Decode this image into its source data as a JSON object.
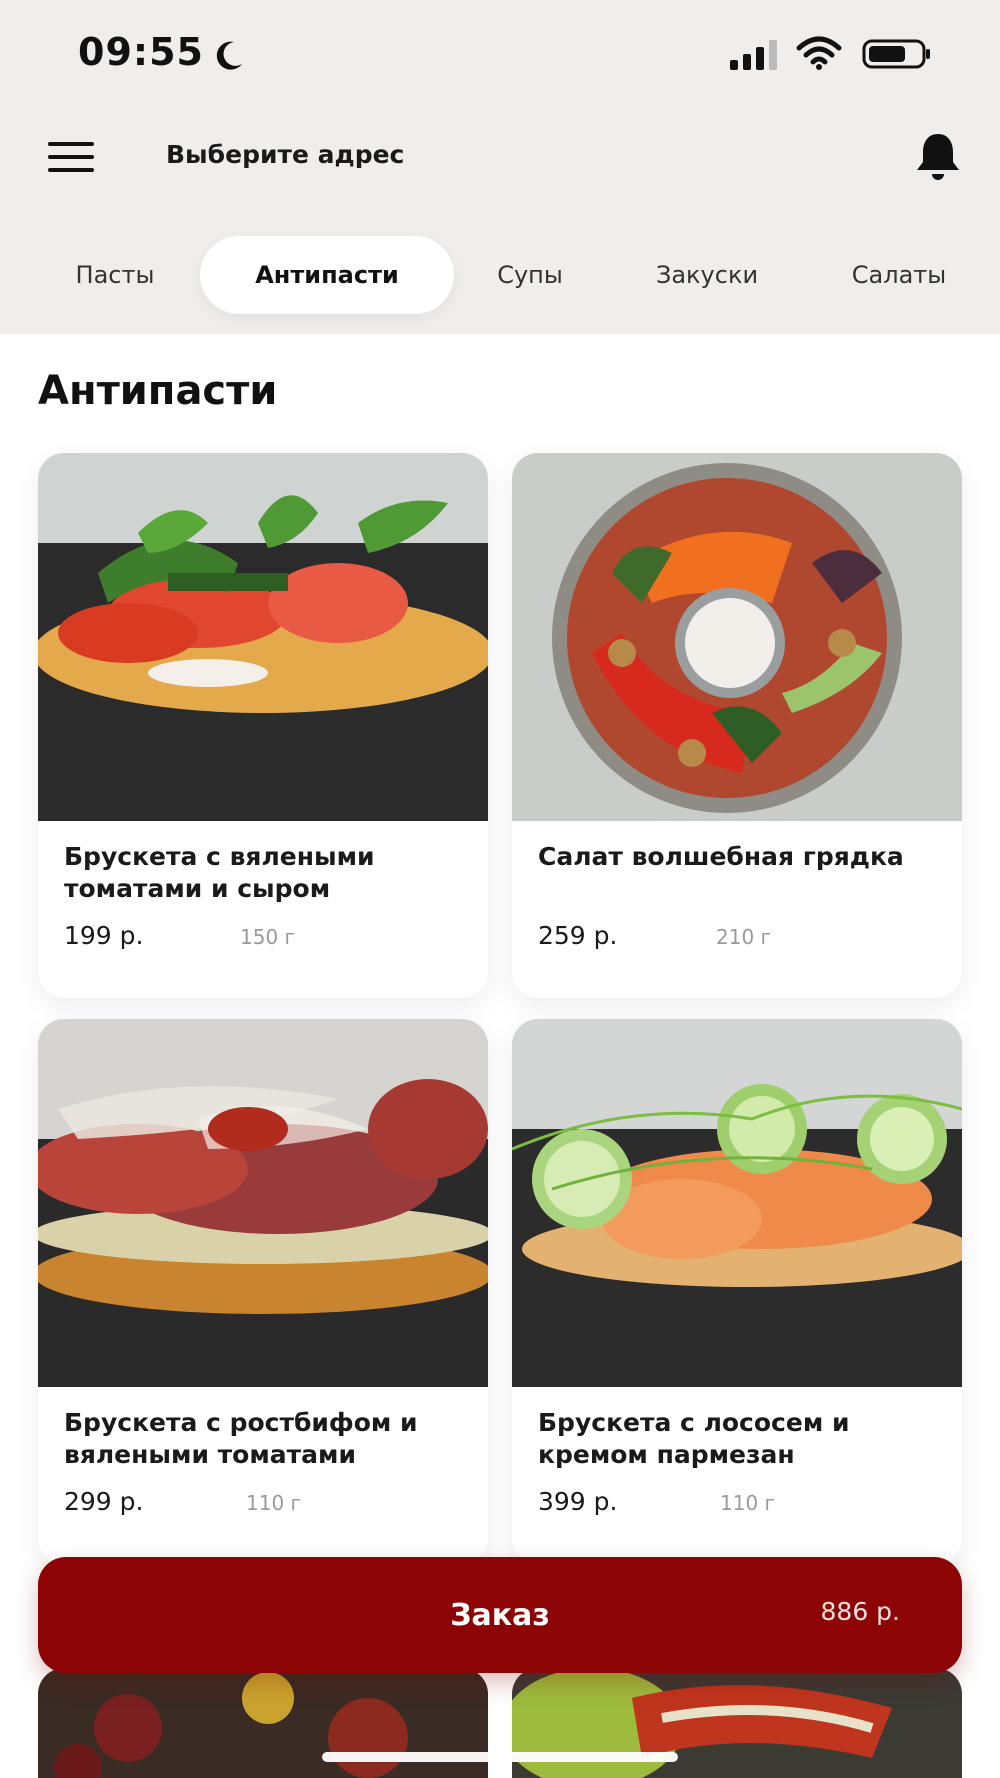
{
  "status_bar": {
    "time": "09:55"
  },
  "header": {
    "address": "Выберите адрес"
  },
  "tabs": [
    {
      "label": "Пасты"
    },
    {
      "label": "Антипасти"
    },
    {
      "label": "Супы"
    },
    {
      "label": "Закуски"
    },
    {
      "label": "Салаты"
    }
  ],
  "active_tab": "Антипасти",
  "section_title": "Антипасти",
  "products": [
    {
      "name": "Брускета с вялеными томатами и сыром",
      "price": "199 р.",
      "weight": "150 г"
    },
    {
      "name": "Салат волшебная грядка",
      "price": "259 р.",
      "weight": "210 г"
    },
    {
      "name": "Брускета с ростбифом и вялеными томатами",
      "price": "299 р.",
      "weight": "110 г"
    },
    {
      "name": "Брускета с лососем и кремом пармезан",
      "price": "399 р.",
      "weight": "110 г"
    }
  ],
  "order": {
    "label": "Заказ",
    "total": "886 р."
  },
  "colors": {
    "accent": "#8c0404",
    "header_bg": "#efeeec"
  }
}
